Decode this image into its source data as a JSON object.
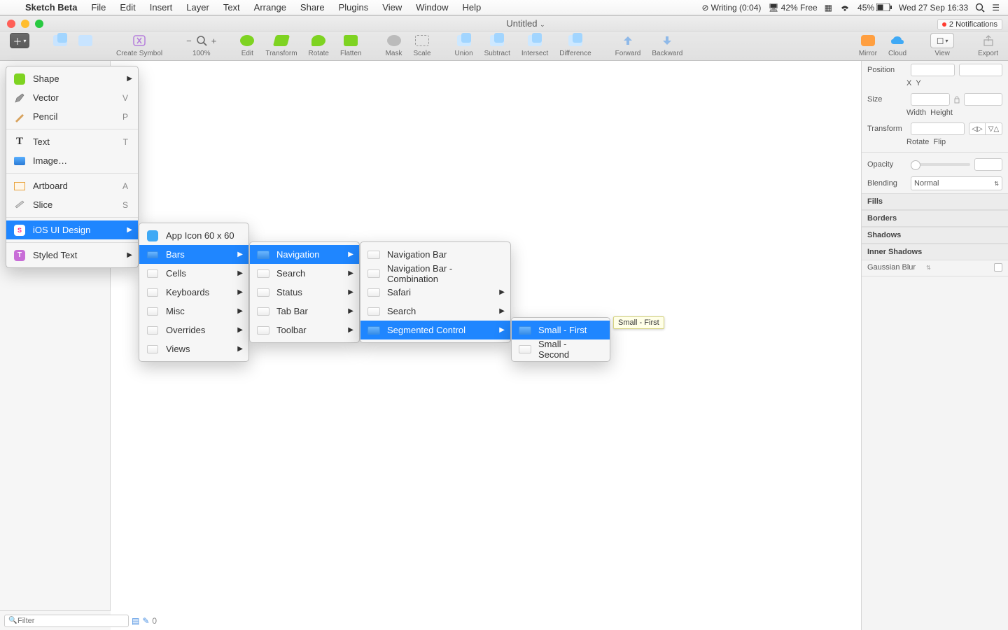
{
  "menubar": {
    "app": "Sketch Beta",
    "items": [
      "File",
      "Edit",
      "Insert",
      "Layer",
      "Text",
      "Arrange",
      "Share",
      "Plugins",
      "View",
      "Window",
      "Help"
    ],
    "right": {
      "writing": "Writing (0:04)",
      "mem": "42% Free",
      "wifi": "45%",
      "date": "Wed 27 Sep  16:33"
    }
  },
  "window": {
    "title": "Untitled",
    "notifications": "2 Notifications"
  },
  "toolbar": {
    "zoom": "100%",
    "items": [
      "Create Symbol",
      "Edit",
      "Transform",
      "Rotate",
      "Flatten",
      "Mask",
      "Scale",
      "Union",
      "Subtract",
      "Intersect",
      "Difference",
      "Forward",
      "Backward",
      "Mirror",
      "Cloud",
      "View",
      "Export"
    ]
  },
  "insert_menu": [
    {
      "label": "Shape",
      "kb": "",
      "sub": true,
      "icon": "green"
    },
    {
      "label": "Vector",
      "kb": "V",
      "icon": "pen"
    },
    {
      "label": "Pencil",
      "kb": "P",
      "icon": "pencil"
    },
    {
      "sep": true
    },
    {
      "label": "Text",
      "kb": "T",
      "icon": "text"
    },
    {
      "label": "Image…",
      "kb": "",
      "icon": "img"
    },
    {
      "sep": true
    },
    {
      "label": "Artboard",
      "kb": "A",
      "icon": "art"
    },
    {
      "label": "Slice",
      "kb": "S",
      "icon": "slice"
    },
    {
      "sep": true
    },
    {
      "label": "iOS UI Design",
      "sub": true,
      "icon": "ios",
      "sel": true
    },
    {
      "sep": true
    },
    {
      "label": "Styled Text",
      "sub": true,
      "icon": "styled"
    }
  ],
  "ios_menu": [
    {
      "label": "App Icon 60 x 60"
    },
    {
      "label": "Bars",
      "sub": true,
      "sel": true
    },
    {
      "label": "Cells",
      "sub": true
    },
    {
      "label": "Keyboards",
      "sub": true
    },
    {
      "label": "Misc",
      "sub": true
    },
    {
      "label": "Overrides",
      "sub": true
    },
    {
      "label": "Views",
      "sub": true
    }
  ],
  "bars_menu": [
    {
      "label": "Navigation",
      "sub": true,
      "sel": true
    },
    {
      "label": "Search",
      "sub": true
    },
    {
      "label": "Status",
      "sub": true
    },
    {
      "label": "Tab Bar",
      "sub": true
    },
    {
      "label": "Toolbar",
      "sub": true
    }
  ],
  "nav_menu": [
    {
      "label": "Navigation Bar"
    },
    {
      "label": "Navigation Bar - Combination"
    },
    {
      "label": "Safari",
      "sub": true
    },
    {
      "label": "Search",
      "sub": true
    },
    {
      "label": "Segmented Control",
      "sub": true,
      "sel": true
    }
  ],
  "seg_menu": [
    {
      "label": "Small - First",
      "sel": true
    },
    {
      "label": "Small - Second"
    }
  ],
  "tooltip": "Small - First",
  "inspector": {
    "position": "Position",
    "x": "X",
    "y": "Y",
    "size": "Size",
    "width": "Width",
    "height": "Height",
    "transform": "Transform",
    "rotate": "Rotate",
    "flip": "Flip",
    "opacity": "Opacity",
    "blending": "Blending",
    "blending_value": "Normal",
    "sections": [
      "Fills",
      "Borders",
      "Shadows",
      "Inner Shadows"
    ],
    "gaussian": "Gaussian Blur"
  },
  "footer": {
    "filter_placeholder": "Filter",
    "count": "0"
  }
}
